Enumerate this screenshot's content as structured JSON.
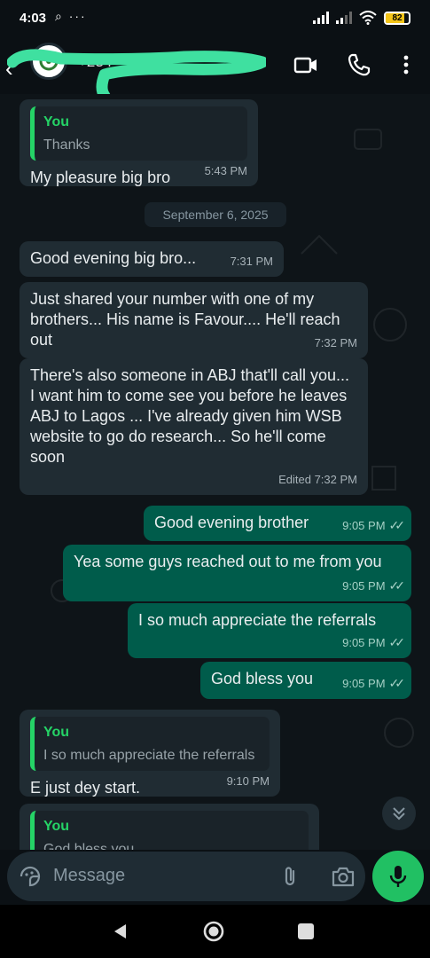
{
  "status_bar": {
    "time": "4:03",
    "notif_icons": "⌕ ···",
    "battery": "82"
  },
  "header": {
    "contact": "+234 ··· 4386"
  },
  "chat": {
    "messages": [
      {
        "dir": "in",
        "quote_name": "You",
        "quote_text": "Thanks",
        "text": "My pleasure big bro",
        "time": "5:43 PM"
      },
      {
        "dir": "date",
        "text": "September 6, 2025"
      },
      {
        "dir": "in",
        "text": "Good evening big bro...",
        "time": "7:31 PM"
      },
      {
        "dir": "in",
        "text": "Just shared your number with one of my brothers... His name is Favour.... He'll reach out",
        "time": "7:32 PM"
      },
      {
        "dir": "in",
        "text": "There's also someone in ABJ that'll call you... I want him to come see you before he leaves ABJ to Lagos ... I've already given him WSB website to go do research... So he'll come soon",
        "time": "Edited 7:32 PM"
      },
      {
        "dir": "out",
        "text": "Good evening brother",
        "time": "9:05 PM"
      },
      {
        "dir": "out",
        "text": "Yea some guys reached out to me from you",
        "time": "9:05 PM"
      },
      {
        "dir": "out",
        "text": "I so much appreciate the referrals",
        "time": "9:05 PM"
      },
      {
        "dir": "out",
        "text": "God bless you",
        "time": "9:05 PM"
      },
      {
        "dir": "in",
        "quote_name": "You",
        "quote_text": "I so much appreciate the referrals",
        "text": "E just dey start.",
        "time": "9:10 PM"
      },
      {
        "dir": "in",
        "quote_name": "You",
        "quote_text": "God bless you",
        "text": "",
        "time": ""
      }
    ],
    "read_ticks": "✓✓"
  },
  "composer": {
    "placeholder": "Message"
  },
  "colors": {
    "incoming": "#202c33",
    "outgoing": "#005c4b",
    "accent": "#25d366",
    "background": "#0e1418"
  }
}
